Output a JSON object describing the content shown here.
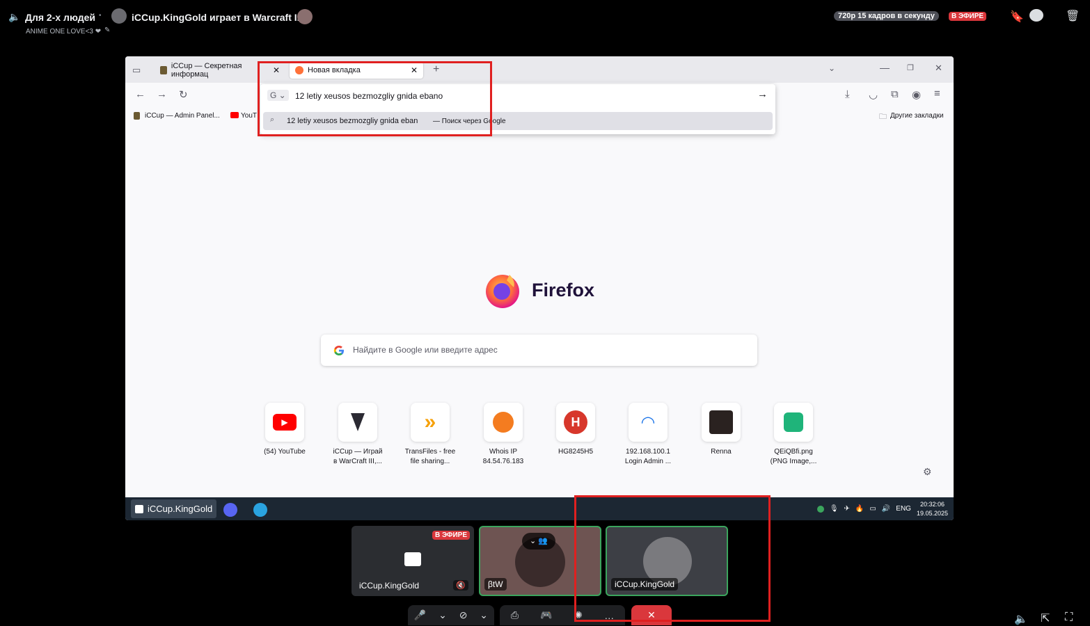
{
  "discord": {
    "channel_name": "Для 2-х людей",
    "stream_title": "iCCup.KingGold играет в Warcraft III",
    "status": "ANIME ONE LOVE<3 ❤",
    "quality": "720p 15 кадров в секунду",
    "live_badge": "В ЭФИРЕ",
    "icons": [
      "speaker-icon",
      "bookmark-icon",
      "chat-icon",
      "trash-icon"
    ]
  },
  "browser": {
    "tabs": [
      {
        "label": "iCCup — Секретная информац",
        "active": false
      },
      {
        "label": "Новая вкладка",
        "active": true
      }
    ],
    "url_value": "12 letiy xeusos bezmozgliy gnida ebanо",
    "suggestion_query": "12 letiy xeusos bezmozgliy gnida eban",
    "suggestion_engine": "— Поиск через Google",
    "search_engine_letter": "G",
    "bookmarks": [
      "iCCup — Admin Panel...",
      "YouT"
    ],
    "other_bookmarks": "Другие закладки",
    "brand": "Firefox",
    "search_placeholder": "Найдите в Google или введите адрес",
    "top_sites": [
      {
        "line1": "(54) YouTube",
        "line2": ""
      },
      {
        "line1": "iCCup — Играй",
        "line2": "в WarCraft III,..."
      },
      {
        "line1": "TransFiles - free",
        "line2": "file sharing..."
      },
      {
        "line1": "Whois IP",
        "line2": "84.54.76.183"
      },
      {
        "line1": "HG8245H5",
        "line2": ""
      },
      {
        "line1": "192.168.100.1",
        "line2": "Login Admin ..."
      },
      {
        "line1": "Renna",
        "line2": ""
      },
      {
        "line1": "QEiQBfi.png",
        "line2": "(PNG Image,..."
      }
    ]
  },
  "taskbar": {
    "pinned_label": "iCCup.KingGold",
    "lang": "ENG",
    "time": "20:32:06",
    "date": "19.05.2025"
  },
  "participants": [
    {
      "name": "iCCup.KingGold",
      "badge": "В ЭФИРЕ",
      "type": "stream"
    },
    {
      "name": "βtW",
      "type": "user"
    },
    {
      "name": "iCCup.KingGold",
      "type": "user"
    }
  ],
  "colors": {
    "live_red": "#da373c",
    "speaking_green": "#3ba55d",
    "annotation_red": "#e02020"
  }
}
